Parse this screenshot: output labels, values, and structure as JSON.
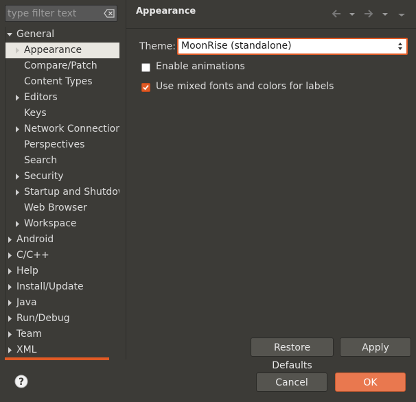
{
  "filter": {
    "placeholder": "type filter text"
  },
  "tree": [
    {
      "label": "General",
      "depth": 0,
      "expanded": true
    },
    {
      "label": "Appearance",
      "depth": 1,
      "selected": true
    },
    {
      "label": "Compare/Patch",
      "depth": 1
    },
    {
      "label": "Content Types",
      "depth": 1
    },
    {
      "label": "Editors",
      "depth": 1,
      "collapsed": true
    },
    {
      "label": "Keys",
      "depth": 1
    },
    {
      "label": "Network Connection",
      "depth": 1,
      "collapsed": true
    },
    {
      "label": "Perspectives",
      "depth": 1
    },
    {
      "label": "Search",
      "depth": 1
    },
    {
      "label": "Security",
      "depth": 1,
      "collapsed": true
    },
    {
      "label": "Startup and Shutdow",
      "depth": 1,
      "collapsed": true
    },
    {
      "label": "Web Browser",
      "depth": 1
    },
    {
      "label": "Workspace",
      "depth": 1,
      "collapsed": true
    },
    {
      "label": "Android",
      "depth": 0,
      "collapsed": true
    },
    {
      "label": "C/C++",
      "depth": 0,
      "collapsed": true
    },
    {
      "label": "Help",
      "depth": 0,
      "collapsed": true
    },
    {
      "label": "Install/Update",
      "depth": 0,
      "collapsed": true
    },
    {
      "label": "Java",
      "depth": 0,
      "collapsed": true
    },
    {
      "label": "Run/Debug",
      "depth": 0,
      "collapsed": true
    },
    {
      "label": "Team",
      "depth": 0,
      "collapsed": true
    },
    {
      "label": "XML",
      "depth": 0,
      "collapsed": true
    }
  ],
  "page": {
    "title": "Appearance",
    "theme_label": "Theme:",
    "theme_value": "MoonRise (standalone)",
    "enable_animations": {
      "label": "Enable animations",
      "checked": false
    },
    "mixed_fonts": {
      "label": "Use mixed fonts and colors for labels",
      "checked": true
    }
  },
  "buttons": {
    "restore_defaults": "Restore Defaults",
    "apply": "Apply",
    "cancel": "Cancel",
    "ok": "OK"
  },
  "colors": {
    "accent": "#e05a25",
    "background": "#3c3b37",
    "ok_button": "#e9784f"
  },
  "icons": {
    "clear": "clear-filter-icon",
    "back": "back-arrow-icon",
    "forward": "forward-arrow-icon",
    "menu": "view-menu-icon",
    "help": "help-icon"
  }
}
